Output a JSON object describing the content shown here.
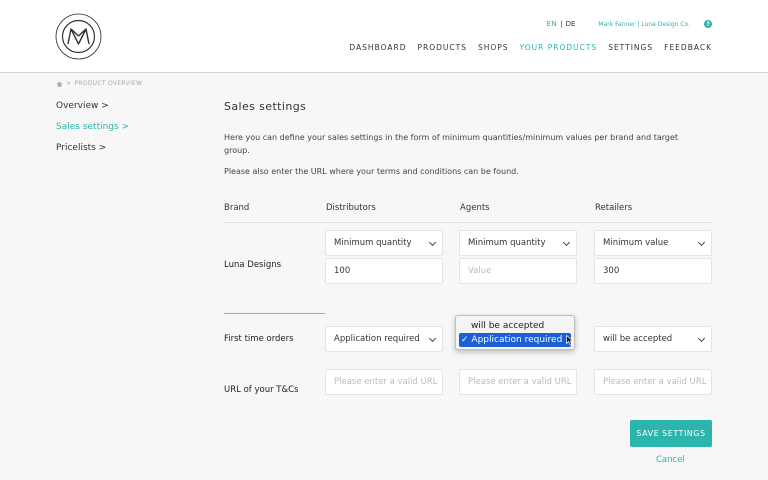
{
  "header": {
    "lang_active": "EN",
    "lang_sep": "|",
    "lang_other": "DE",
    "user": "Mark Fanner | Luna Design Co.",
    "help_icon": "help-icon",
    "nav": [
      "DASHBOARD",
      "PRODUCTS",
      "SHOPS",
      "YOUR PRODUCTS",
      "SETTINGS",
      "FEEDBACK"
    ],
    "nav_active": "YOUR PRODUCTS"
  },
  "breadcrumb": {
    "icon": "home-icon",
    "sep": ">",
    "text": "PRODUCT OVERVIEW"
  },
  "sidebar": {
    "items": [
      {
        "label": "Overview  >"
      },
      {
        "label": "Sales settings  >"
      },
      {
        "label": "Pricelists  >"
      }
    ],
    "active_index": 1
  },
  "main": {
    "title": "Sales settings",
    "desc1": "Here you can define your sales settings in the form of minimum quantities/minimum values per brand and target group.",
    "desc2": "Please also enter the URL where your terms and conditions can be found.",
    "columns": [
      "Brand",
      "Distributors",
      "Agents",
      "Retailers"
    ],
    "brand_row": {
      "label": "Luna Designs",
      "distributors_select": "Minimum quantity",
      "agents_select": "Minimum quantity",
      "retailers_select": "Minimum value",
      "distributors_value": "100",
      "agents_placeholder": "Value",
      "retailers_value": "300"
    },
    "first_orders": {
      "label": "First time orders",
      "distributors": "Application required",
      "retailers": "will be accepted"
    },
    "tc": {
      "label": "URL of your T&Cs",
      "placeholder": "Please enter a valid URL"
    },
    "dropdown": {
      "options": [
        "will be accepted",
        "Application required"
      ],
      "selected_index": 1,
      "checkmark": "✓"
    },
    "save_label": "SAVE SETTINGS",
    "cancel_label": "Cancel"
  },
  "colors": {
    "accent": "#2bb5ac",
    "selection": "#1a5fd6"
  }
}
